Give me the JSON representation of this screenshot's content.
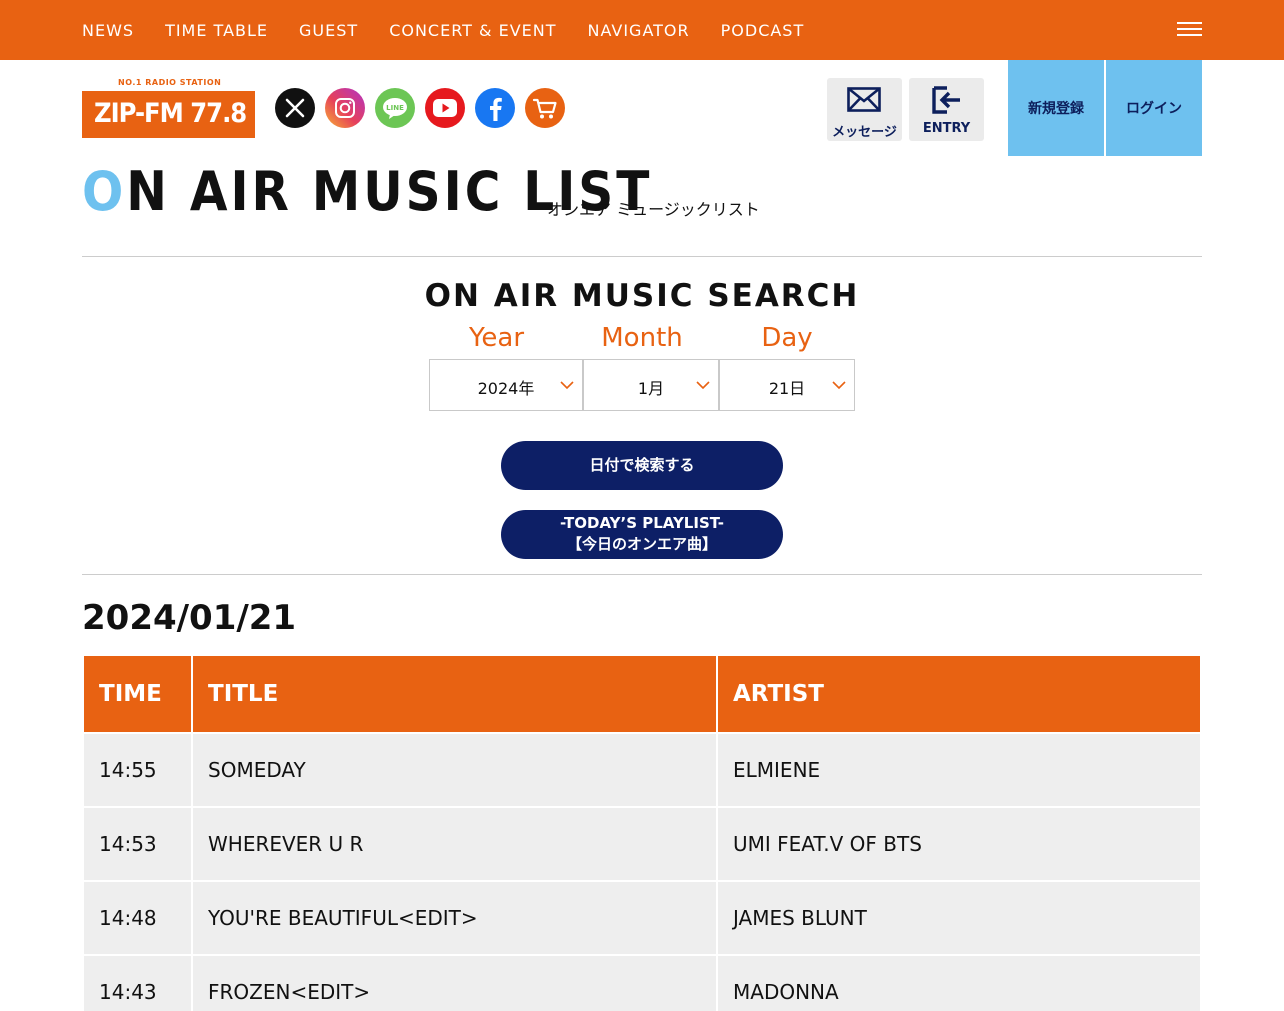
{
  "nav": {
    "items": [
      "NEWS",
      "TIME TABLE",
      "GUEST",
      "CONCERT & EVENT",
      "NAVIGATOR",
      "PODCAST"
    ]
  },
  "logo": {
    "station": "NO.1 RADIO STATION",
    "name": "ZIP-FM 77.8"
  },
  "social": {
    "icons": [
      "x-icon",
      "instagram-icon",
      "line-icon",
      "youtube-icon",
      "facebook-icon",
      "cart-icon"
    ],
    "line_label": "LINE"
  },
  "header_buttons": {
    "message": "メッセージ",
    "entry": "ENTRY",
    "register": "新規登録",
    "login": "ログイン"
  },
  "page": {
    "title_first": "O",
    "title_rest": "N AIR MUSIC LIST",
    "title_jp": "オンエア ミュージックリスト"
  },
  "search": {
    "title": "ON AIR MUSIC SEARCH",
    "year_label": "Year",
    "month_label": "Month",
    "day_label": "Day",
    "year_value": "2024年",
    "month_value": "1月",
    "day_value": "21日",
    "search_button": "日付で検索する",
    "today_line1": "-TODAY’S PLAYLIST-",
    "today_line2": "【今日のオンエア曲】"
  },
  "result": {
    "date": "2024/01/21",
    "columns": [
      "TIME",
      "TITLE",
      "ARTIST"
    ],
    "rows": [
      {
        "time": "14:55",
        "title": "SOMEDAY",
        "artist": "ELMIENE"
      },
      {
        "time": "14:53",
        "title": "WHEREVER U R",
        "artist": "UMI FEAT.V OF BTS"
      },
      {
        "time": "14:48",
        "title": "YOU'RE BEAUTIFUL<EDIT>",
        "artist": "JAMES BLUNT"
      },
      {
        "time": "14:43",
        "title": "FROZEN<EDIT>",
        "artist": "MADONNA"
      }
    ]
  },
  "colors": {
    "brand_orange": "#e86212",
    "light_blue": "#6ec1ef",
    "navy": "#0d1f66"
  }
}
